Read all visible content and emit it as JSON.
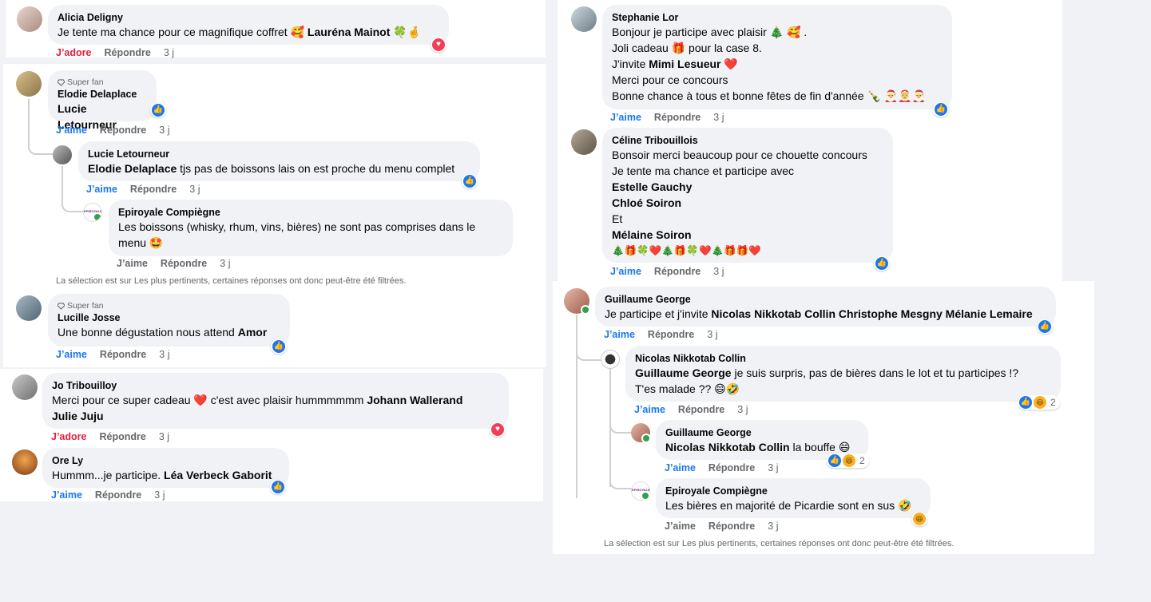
{
  "labels": {
    "like": "J’aime",
    "love": "J’adore",
    "reply": "Répondre",
    "time": "3 j",
    "super_fan": "Super fan",
    "filter_note": "La sélection est sur Les plus pertinents, certaines réponses ont donc peut-être été filtrées."
  },
  "c1": {
    "author": "Alicia Deligny",
    "text": "Je tente ma chance pour ce magnifique coffret 🥰",
    "tag": "Lauréna Mainot",
    "after": "🍀🤞"
  },
  "c2": {
    "author": "Elodie Delaplace",
    "tag": "Lucie Letourneur"
  },
  "c3": {
    "author": "Lucie Letourneur",
    "tag": "Elodie Delaplace",
    "text": "tjs pas de boissons lais on est proche du menu complet"
  },
  "c4": {
    "author": "Epiroyale Compiègne",
    "text": "Les boissons (whisky, rhum, vins, bières) ne sont pas comprises dans le menu 🤩",
    "avatar_text": "EPIROYALE"
  },
  "c5": {
    "author": "Lucille Josse",
    "text": "Une bonne dégustation nous attend",
    "tag": "Amor"
  },
  "c6": {
    "author": "Jo Tribouilloy",
    "text": "Merci pour ce super cadeau ❤️ c'est avec plaisir hummmmmm",
    "tag1": "Johann Wallerand",
    "tag2": "Julie Juju"
  },
  "c7": {
    "author": "Ore Ly",
    "text": "Hummm...je participe.",
    "tag": "Léa Verbeck Gaborit"
  },
  "c8": {
    "author": "Stephanie Lor",
    "l1": "Bonjour je participe avec plaisir 🎄 🥰 .",
    "l2": "Joli cadeau 🎁 pour la case 8.",
    "l3a": "J'invite",
    "l3tag": "Mimi Lesueur",
    "l3b": "❤️",
    "l4": "Merci pour ce concours",
    "l5": "Bonne chance à tous et bonne fêtes de fin d'année 🍾 🎅🤶🎅"
  },
  "c9": {
    "author": "Céline Tribouillois",
    "l1": "Bonsoir merci beaucoup pour ce chouette concours",
    "l2": "Je tente ma chance et participe avec",
    "t1": "Estelle Gauchy",
    "t2": "Chloé Soiron",
    "l3": "Et",
    "t3": "Mélaine Soiron",
    "emoji": "🎄🎁🍀❤️🎄🎁🍀❤️🎄🎁🎁❤️"
  },
  "c10": {
    "author": "Guillaume George",
    "text": "Je participe et j'invite",
    "tags": "Nicolas Nikkotab Collin Christophe Mesgny Mélanie Lemaire"
  },
  "c11": {
    "author": "Nicolas Nikkotab Collin",
    "tag": "Guillaume George",
    "text": "je suis surpris, pas de bières dans le lot et tu participes !?",
    "l2": "T'es malade ?? 😄🤣",
    "count": "2"
  },
  "c12": {
    "author": "Guillaume George",
    "tag": "Nicolas Nikkotab Collin",
    "text": "la bouffe 😄",
    "count": "2"
  },
  "c13": {
    "author": "Epiroyale Compiègne",
    "text": "Les bières en majorité de Picardie sont en sus 🤣",
    "avatar_text": "EPIROYALE"
  }
}
